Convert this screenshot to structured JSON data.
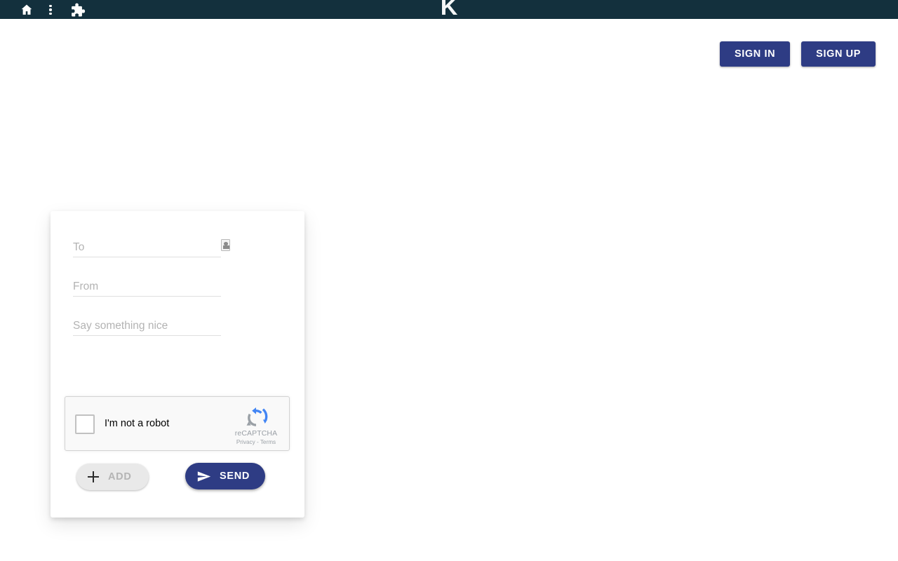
{
  "browser_bar": {
    "title": "K",
    "background_color": "#13303d",
    "icons": [
      {
        "name": "home-icon",
        "label": "Home"
      },
      {
        "name": "vertical-dots-menu-icon",
        "label": "Menu"
      },
      {
        "name": "puzzle-extensions-icon",
        "label": "Extensions"
      }
    ]
  },
  "header": {
    "sign_in_label": "SIGN IN",
    "sign_up_label": "SIGN UP",
    "button_color": "#2e3c84"
  },
  "form": {
    "to": {
      "value": "",
      "placeholder": "To"
    },
    "from": {
      "value": "",
      "placeholder": "From"
    },
    "message": {
      "value": "",
      "placeholder": "Say something nice"
    },
    "contact_picker_icon": "contact-card-icon"
  },
  "recaptcha": {
    "label": "I'm not a robot",
    "brand": "reCAPTCHA",
    "privacy_label": "Privacy",
    "separator": "-",
    "terms_label": "Terms",
    "checked": false,
    "logo_blue": "#4285f4",
    "logo_gray": "#9aa0a6"
  },
  "actions": {
    "add_label": "ADD",
    "send_label": "SEND",
    "add_disabled": true
  }
}
